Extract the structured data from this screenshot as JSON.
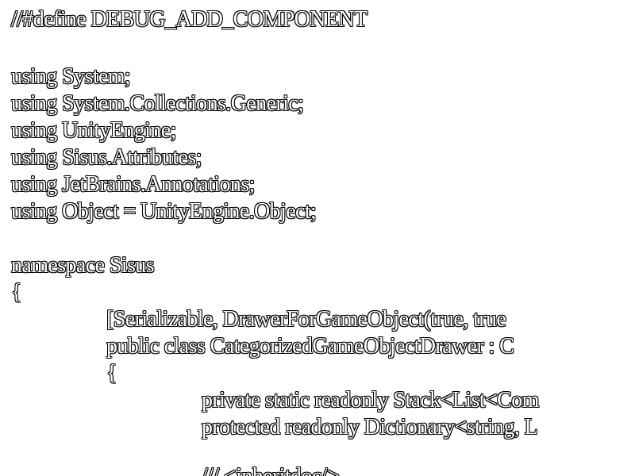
{
  "editor": {
    "lines": [
      "//#define DEBUG_ADD_COMPONENT",
      "",
      "using System;",
      "using System.Collections.Generic;",
      "using UnityEngine;",
      "using Sisus.Attributes;",
      "using JetBrains.Annotations;",
      "using Object = UnityEngine.Object;",
      "",
      "namespace Sisus",
      "{",
      "[Serializable, DrawerForGameObject(true, true",
      "public class CategorizedGameObjectDrawer : C",
      "{",
      "private static readonly Stack<List<Com",
      "protected readonly Dictionary<string, L",
      "",
      "/// <inheritdoc/>"
    ]
  }
}
